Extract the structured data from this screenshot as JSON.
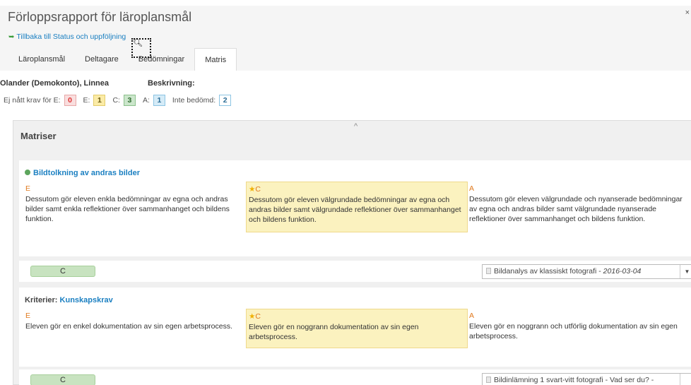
{
  "header": {
    "title": "Förloppsrapport för läroplansmål",
    "back_link": "Tillbaka till Status och uppföljning",
    "close_glyph": "×"
  },
  "tabs": [
    {
      "label": "Läroplansmål"
    },
    {
      "label": "Deltagare"
    },
    {
      "label": "Bedömningar"
    },
    {
      "label": "Matris",
      "active": true
    }
  ],
  "student": {
    "name": "Olander (Demokonto), Linnea",
    "description_label": "Beskrivning:"
  },
  "legend": {
    "not_met_label": "Ej nått krav för E:",
    "not_met_count": "0",
    "e_label": "E:",
    "e_count": "1",
    "c_label": "C:",
    "c_count": "3",
    "a_label": "A:",
    "a_count": "1",
    "not_assessed_label": "Inte bedömd:",
    "not_assessed_count": "2"
  },
  "matrix": {
    "title": "Matriser",
    "collapse_glyph": "^",
    "criteria": [
      {
        "prefix": "",
        "title": "Bildtolkning av andras bilder",
        "levels": [
          {
            "grade": "E",
            "text": "Dessutom gör eleven enkla bedömningar av egna och andras bilder samt enkla reflektioner över sammanhanget och bildens funktion."
          },
          {
            "grade": "C",
            "text": "Dessutom gör eleven välgrundade bedömningar av egna och andras bilder samt välgrundade reflektioner över sammanhanget och bildens funktion.",
            "selected": true
          },
          {
            "grade": "A",
            "text": "Dessutom gör eleven välgrundade och nyanserade bedömningar av egna och andras bilder samt välgrundade nyanserade reflektioner över sammanhanget och bildens funktion."
          }
        ],
        "assigned_grade": "C",
        "assessment": {
          "name": "Bildanalys av klassiskt fotografi",
          "date": "2016-03-04"
        }
      },
      {
        "prefix": "Kriterier:",
        "title": "Kunskapskrav",
        "levels": [
          {
            "grade": "E",
            "text": "Eleven gör en enkel dokumentation av sin egen arbetsprocess."
          },
          {
            "grade": "C",
            "text": "Eleven gör en noggrann dokumentation av sin egen arbetsprocess.",
            "selected": true
          },
          {
            "grade": "A",
            "text": "Eleven gör en noggrann och utförlig dokumentation av sin egen arbetsprocess."
          }
        ],
        "assigned_grade": "C",
        "assessment": {
          "name": "Bildinlämning 1 svart-vitt fotografi - Vad ser du? -",
          "date": ""
        }
      }
    ]
  },
  "colors": {
    "link": "#1a7fc1",
    "grade_letter": "#e07a20",
    "highlight": "#fbf2bf",
    "grade_pill": "#c8e3c0"
  }
}
